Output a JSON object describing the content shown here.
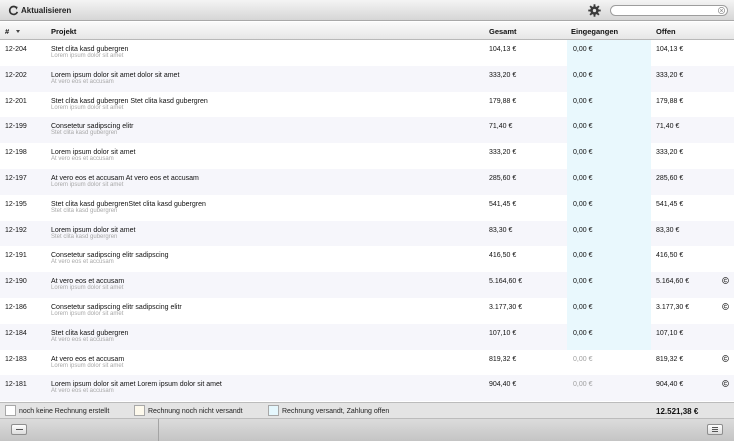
{
  "toolbar": {
    "title": "Aktualisieren",
    "search_value": "",
    "search_placeholder": ""
  },
  "columns": {
    "number": "#",
    "projekt": "Projekt",
    "gesamt": "Gesamt",
    "eingegangen": "Eingegangen",
    "offen": "Offen"
  },
  "rows": [
    {
      "num": "12-204",
      "title": "Stet clita kasd gubergren",
      "subtitle": "Lorem ipsum dolor sit amet",
      "gesamt": "104,13 €",
      "eingegangen": "0,00 €",
      "offen": "104,13 €",
      "note": false,
      "status": "sent",
      "muted": false
    },
    {
      "num": "12-202",
      "title": "Lorem ipsum dolor sit amet dolor sit amet",
      "subtitle": "At vero eos et accusam",
      "gesamt": "333,20 €",
      "eingegangen": "0,00 €",
      "offen": "333,20 €",
      "note": false,
      "status": "sent",
      "muted": false
    },
    {
      "num": "12-201",
      "title": "Stet clita kasd gubergren Stet clita kasd gubergren",
      "subtitle": "Lorem ipsum dolor sit amet",
      "gesamt": "179,88 €",
      "eingegangen": "0,00 €",
      "offen": "179,88 €",
      "note": false,
      "status": "sent",
      "muted": false
    },
    {
      "num": "12-199",
      "title": "Consetetur sadipscing elitr",
      "subtitle": "Stet clita kasd gubergren",
      "gesamt": "71,40 €",
      "eingegangen": "0,00 €",
      "offen": "71,40 €",
      "note": false,
      "status": "sent",
      "muted": false
    },
    {
      "num": "12-198",
      "title": "Lorem ipsum dolor sit amet",
      "subtitle": "At vero eos et accusam",
      "gesamt": "333,20 €",
      "eingegangen": "0,00 €",
      "offen": "333,20 €",
      "note": false,
      "status": "sent",
      "muted": false
    },
    {
      "num": "12-197",
      "title": "At vero eos et accusam At vero eos et accusam",
      "subtitle": "Lorem ipsum dolor sit amet",
      "gesamt": "285,60 €",
      "eingegangen": "0,00 €",
      "offen": "285,60 €",
      "note": false,
      "status": "sent",
      "muted": false
    },
    {
      "num": "12-195",
      "title": "Stet clita kasd gubergrenStet clita kasd gubergren",
      "subtitle": "Stet clita kasd gubergren",
      "gesamt": "541,45 €",
      "eingegangen": "0,00 €",
      "offen": "541,45 €",
      "note": false,
      "status": "sent",
      "muted": false
    },
    {
      "num": "12-192",
      "title": "Lorem ipsum dolor sit amet",
      "subtitle": "Stet clita kasd gubergren",
      "gesamt": "83,30 €",
      "eingegangen": "0,00 €",
      "offen": "83,30 €",
      "note": false,
      "status": "sent",
      "muted": false
    },
    {
      "num": "12-191",
      "title": "Consetetur sadipscing elitr sadipscing",
      "subtitle": "At vero eos et accusam",
      "gesamt": "416,50 €",
      "eingegangen": "0,00 €",
      "offen": "416,50 €",
      "note": false,
      "status": "sent",
      "muted": false
    },
    {
      "num": "12-190",
      "title": "At vero eos et accusam",
      "subtitle": "Lorem ipsum dolor sit amet",
      "gesamt": "5.164,60 €",
      "eingegangen": "0,00 €",
      "offen": "5.164,60 €",
      "note": true,
      "status": "sent",
      "muted": false
    },
    {
      "num": "12-186",
      "title": "Consetetur sadipscing elitr sadipscing elitr",
      "subtitle": "Lorem ipsum dolor sit amet",
      "gesamt": "3.177,30 €",
      "eingegangen": "0,00 €",
      "offen": "3.177,30 €",
      "note": true,
      "status": "sent",
      "muted": false
    },
    {
      "num": "12-184",
      "title": "Stet clita kasd gubergren",
      "subtitle": "At vero eos et accusam",
      "gesamt": "107,10 €",
      "eingegangen": "0,00 €",
      "offen": "107,10 €",
      "note": false,
      "status": "sent",
      "muted": false
    },
    {
      "num": "12-183",
      "title": "At vero eos et accusam",
      "subtitle": "Lorem ipsum dolor sit amet",
      "gesamt": "819,32 €",
      "eingegangen": "0,00 €",
      "offen": "819,32 €",
      "note": true,
      "status": "none",
      "muted": true
    },
    {
      "num": "12-181",
      "title": "Lorem ipsum dolor sit amet Lorem ipsum dolor sit amet",
      "subtitle": "At vero eos et accusam",
      "gesamt": "904,40 €",
      "eingegangen": "0,00 €",
      "offen": "904,40 €",
      "note": true,
      "status": "none",
      "muted": true
    }
  ],
  "legend": {
    "none": {
      "label": "noch keine Rechnung erstellt",
      "color": "#ffffff"
    },
    "unsent": {
      "label": "Rechnung noch nicht versandt",
      "color": "#fdf9ec"
    },
    "sent": {
      "label": "Rechnung versandt, Zahlung offen",
      "color": "#e5f7fd"
    }
  },
  "total": "12.521,38 €",
  "colors": {
    "eingegangen_bg": "#e9f8fd",
    "alt_row": "#f6f6fb",
    "subtitle": "#a8a8a8"
  },
  "icons": {
    "refresh": "refresh-icon",
    "gear": "gear-icon",
    "search_clear": "search-clear-icon",
    "sort": "sort-down-icon",
    "note": "copyright-note-icon",
    "remove": "minus-icon",
    "menu": "list-menu-icon"
  }
}
